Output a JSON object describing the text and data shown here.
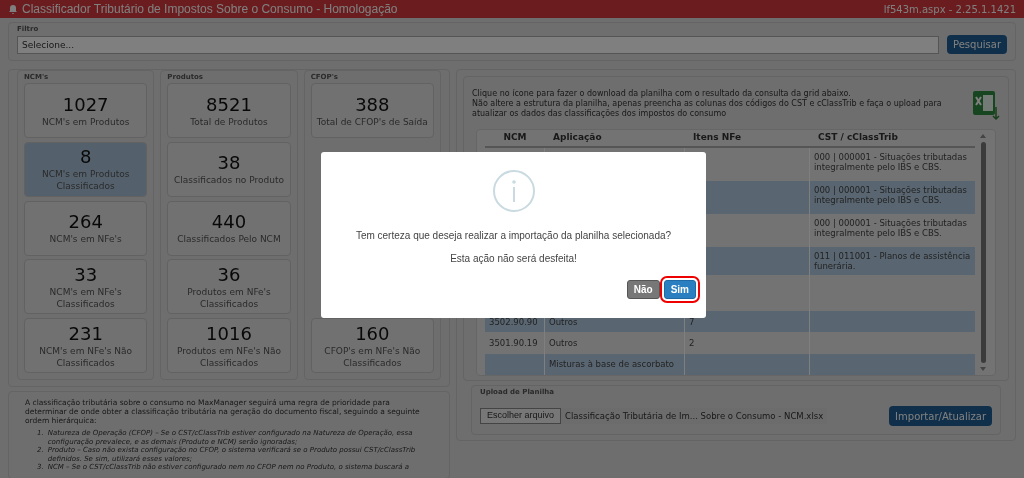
{
  "header": {
    "title": "Classificador Tributário de Impostos Sobre o Consumo  - Homologação",
    "version": "lf543m.aspx - 2.25.1.1421"
  },
  "filter": {
    "legend": "Filtro",
    "placeholder": "Selecione...",
    "button": "Pesquisar"
  },
  "stat_groups": [
    {
      "title": "NCM's",
      "cards": [
        {
          "value": "1027",
          "label": "NCM's em Produtos",
          "selected": false
        },
        {
          "value": "8",
          "label": "NCM's em Produtos Classificados",
          "selected": true
        },
        {
          "value": "264",
          "label": "NCM's em NFe's",
          "selected": false
        },
        {
          "value": "33",
          "label": "NCM's em NFe's Classificados",
          "selected": false
        },
        {
          "value": "231",
          "label": "NCM's em NFe's Não Classificados",
          "selected": false
        }
      ]
    },
    {
      "title": "Produtos",
      "cards": [
        {
          "value": "8521",
          "label": "Total de Produtos",
          "selected": false
        },
        {
          "value": "38",
          "label": "Classificados no Produto",
          "selected": false
        },
        {
          "value": "440",
          "label": "Classificados Pelo NCM",
          "selected": false
        },
        {
          "value": "36",
          "label": "Produtos em NFe's Classificados",
          "selected": false
        },
        {
          "value": "1016",
          "label": "Produtos em NFe's Não Classificados",
          "selected": false
        }
      ]
    },
    {
      "title": "CFOP's",
      "cards": [
        {
          "value": "388",
          "label": "Total de CFOP's de Saída",
          "selected": false
        },
        {
          "value": "160",
          "label": "CFOP's em NFe's Não Classificados",
          "selected": false
        }
      ]
    }
  ],
  "info_text": [
    "Clique no ícone para fazer o download da planilha com o resultado da consulta da grid abaixo.",
    "Não altere a estrutura da planilha, apenas preencha as colunas dos códigos do CST e cClassTrib e faça o upload para atualizar os dados das classificações dos impostos do consumo"
  ],
  "table": {
    "columns": [
      "NCM",
      "Aplicação",
      "Itens NFe",
      "CST / cClassTrib"
    ],
    "rows": [
      {
        "cst": "000 | 000001 - Situações tributadas integralmente pelo IBS e CBS."
      },
      {
        "cst": "000 | 000001 - Situações tributadas integralmente pelo IBS e CBS."
      },
      {
        "cst": "000 | 000001 - Situações tributadas integralmente pelo IBS e CBS."
      },
      {
        "cst": "011 | 011001 - Planos de assistência funerária."
      },
      {},
      {
        "ncm": "3502.90.90",
        "aplicacao": "Outros",
        "itens": "7"
      },
      {
        "ncm": "3501.90.19",
        "aplicacao": "Outros",
        "itens": "2"
      },
      {
        "aplicacao": "Misturas à base de ascorbato"
      }
    ]
  },
  "upload": {
    "legend": "Upload de Planilha",
    "file_button": "Escolher arquivo",
    "file_name": "Classificação Tributária de Im... Sobre o Consumo - NCM.xlsx",
    "button": "Importar/Atualizar"
  },
  "description": {
    "intro": "A classificação tributária sobre o consumo no MaxManager seguirá uma regra de prioridade para determinar de onde obter a classificação tributária na geração do documento fiscal, seguindo a seguinte ordem hierárquica:",
    "items": [
      {
        "number": "1.",
        "text": "Natureza de Operação (CFOP) – Se o CST/cClassTrib estiver configurado na Natureza de Operação, essa configuração prevalece, e as demais (Produto e NCM) serão ignoradas;"
      },
      {
        "number": "2.",
        "text": "Produto – Caso não exista configuração no CFOP, o sistema verificará se o Produto possui CST/cClassTrib definidos. Se sim, utilizará esses valores;"
      },
      {
        "number": "3.",
        "text": "NCM – Se o CST/cClassTrib não estiver configurado nem no CFOP nem no Produto, o sistema buscará a"
      }
    ]
  },
  "dialog": {
    "message": "Tem certeza que deseja realizar a importação da planilha selecionada?",
    "note": "Esta ação não será desfeita!",
    "buttons": [
      {
        "kind": "cancel",
        "label": "Não",
        "focused": false
      },
      {
        "kind": "confirm",
        "label": "Sim",
        "focused": true
      }
    ]
  }
}
